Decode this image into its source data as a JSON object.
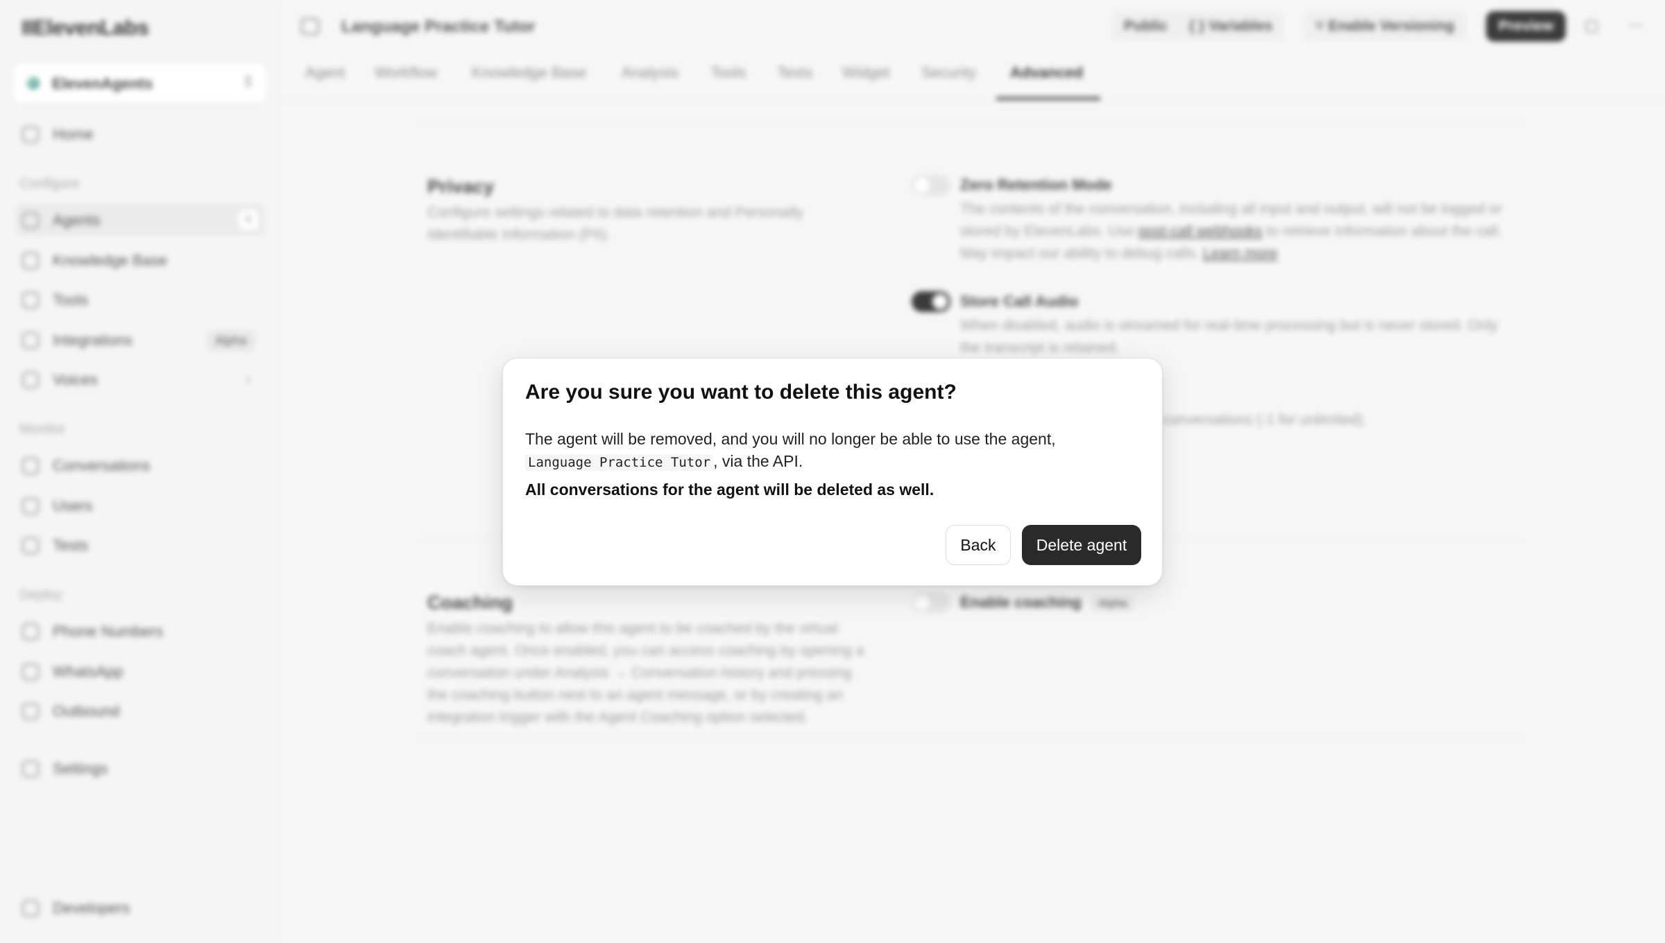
{
  "sidebar": {
    "logo": "IIElevenLabs",
    "workspace": "ElevenAgents",
    "items": [
      {
        "label": "Home"
      },
      {
        "label": "Agents"
      },
      {
        "label": "Knowledge Base"
      },
      {
        "label": "Tools"
      },
      {
        "label": "Integrations",
        "badge": "Alpha"
      },
      {
        "label": "Voices"
      },
      {
        "label": "Conversations"
      },
      {
        "label": "Users"
      },
      {
        "label": "Tests"
      },
      {
        "label": "Phone Numbers"
      },
      {
        "label": "WhatsApp"
      },
      {
        "label": "Outbound"
      },
      {
        "label": "Settings"
      },
      {
        "label": "Developers"
      }
    ],
    "sections": {
      "configure": "Configure",
      "monitor": "Monitor",
      "deploy": "Deploy"
    }
  },
  "topbar": {
    "title": "Language Practice Tutor",
    "public": "Public",
    "variables": "Variables",
    "versioning": "Enable Versioning",
    "preview": "Preview"
  },
  "tabs": [
    "Agent",
    "Workflow",
    "Knowledge Base",
    "Analysis",
    "Tools",
    "Tests",
    "Widget",
    "Security",
    "Advanced"
  ],
  "privacy": {
    "title": "Privacy",
    "desc": "Configure settings related to data retention and Personally Identifiable Information (PII).",
    "zero_retention": {
      "title": "Zero Retention Mode",
      "desc_a": "The contents of the conversation, including all input and output, will not be logged or stored by ElevenLabs. Use",
      "link": "post-call webhooks",
      "desc_b": "to retrieve information about the call. May impact our ability to debug calls.",
      "learn_more": "Learn more"
    },
    "store_audio": {
      "title": "Store Call Audio",
      "desc": "When disabled, audio is streamed for real-time processing but is never stored. Only the transcript is retained."
    },
    "retention_desc": "conversations (-1 for unlimited)."
  },
  "coaching": {
    "title": "Coaching",
    "desc": "Enable coaching to allow this agent to be coached by the virtual coach agent. Once enabled, you can access coaching by opening a conversation under Analysis → Conversation history and pressing the coaching button next to an agent message, or by creating an integration trigger with the Agent Coaching option selected.",
    "enable": "Enable coaching",
    "badge": "Alpha"
  },
  "dialog": {
    "title": "Are you sure you want to delete this agent?",
    "body_before": "The agent will be removed, and you will no longer be able to use the agent,",
    "agent_name": "Language Practice Tutor",
    "body_after": ", via the API.",
    "warning": "All conversations for the agent will be deleted as well.",
    "back": "Back",
    "delete": "Delete agent"
  }
}
